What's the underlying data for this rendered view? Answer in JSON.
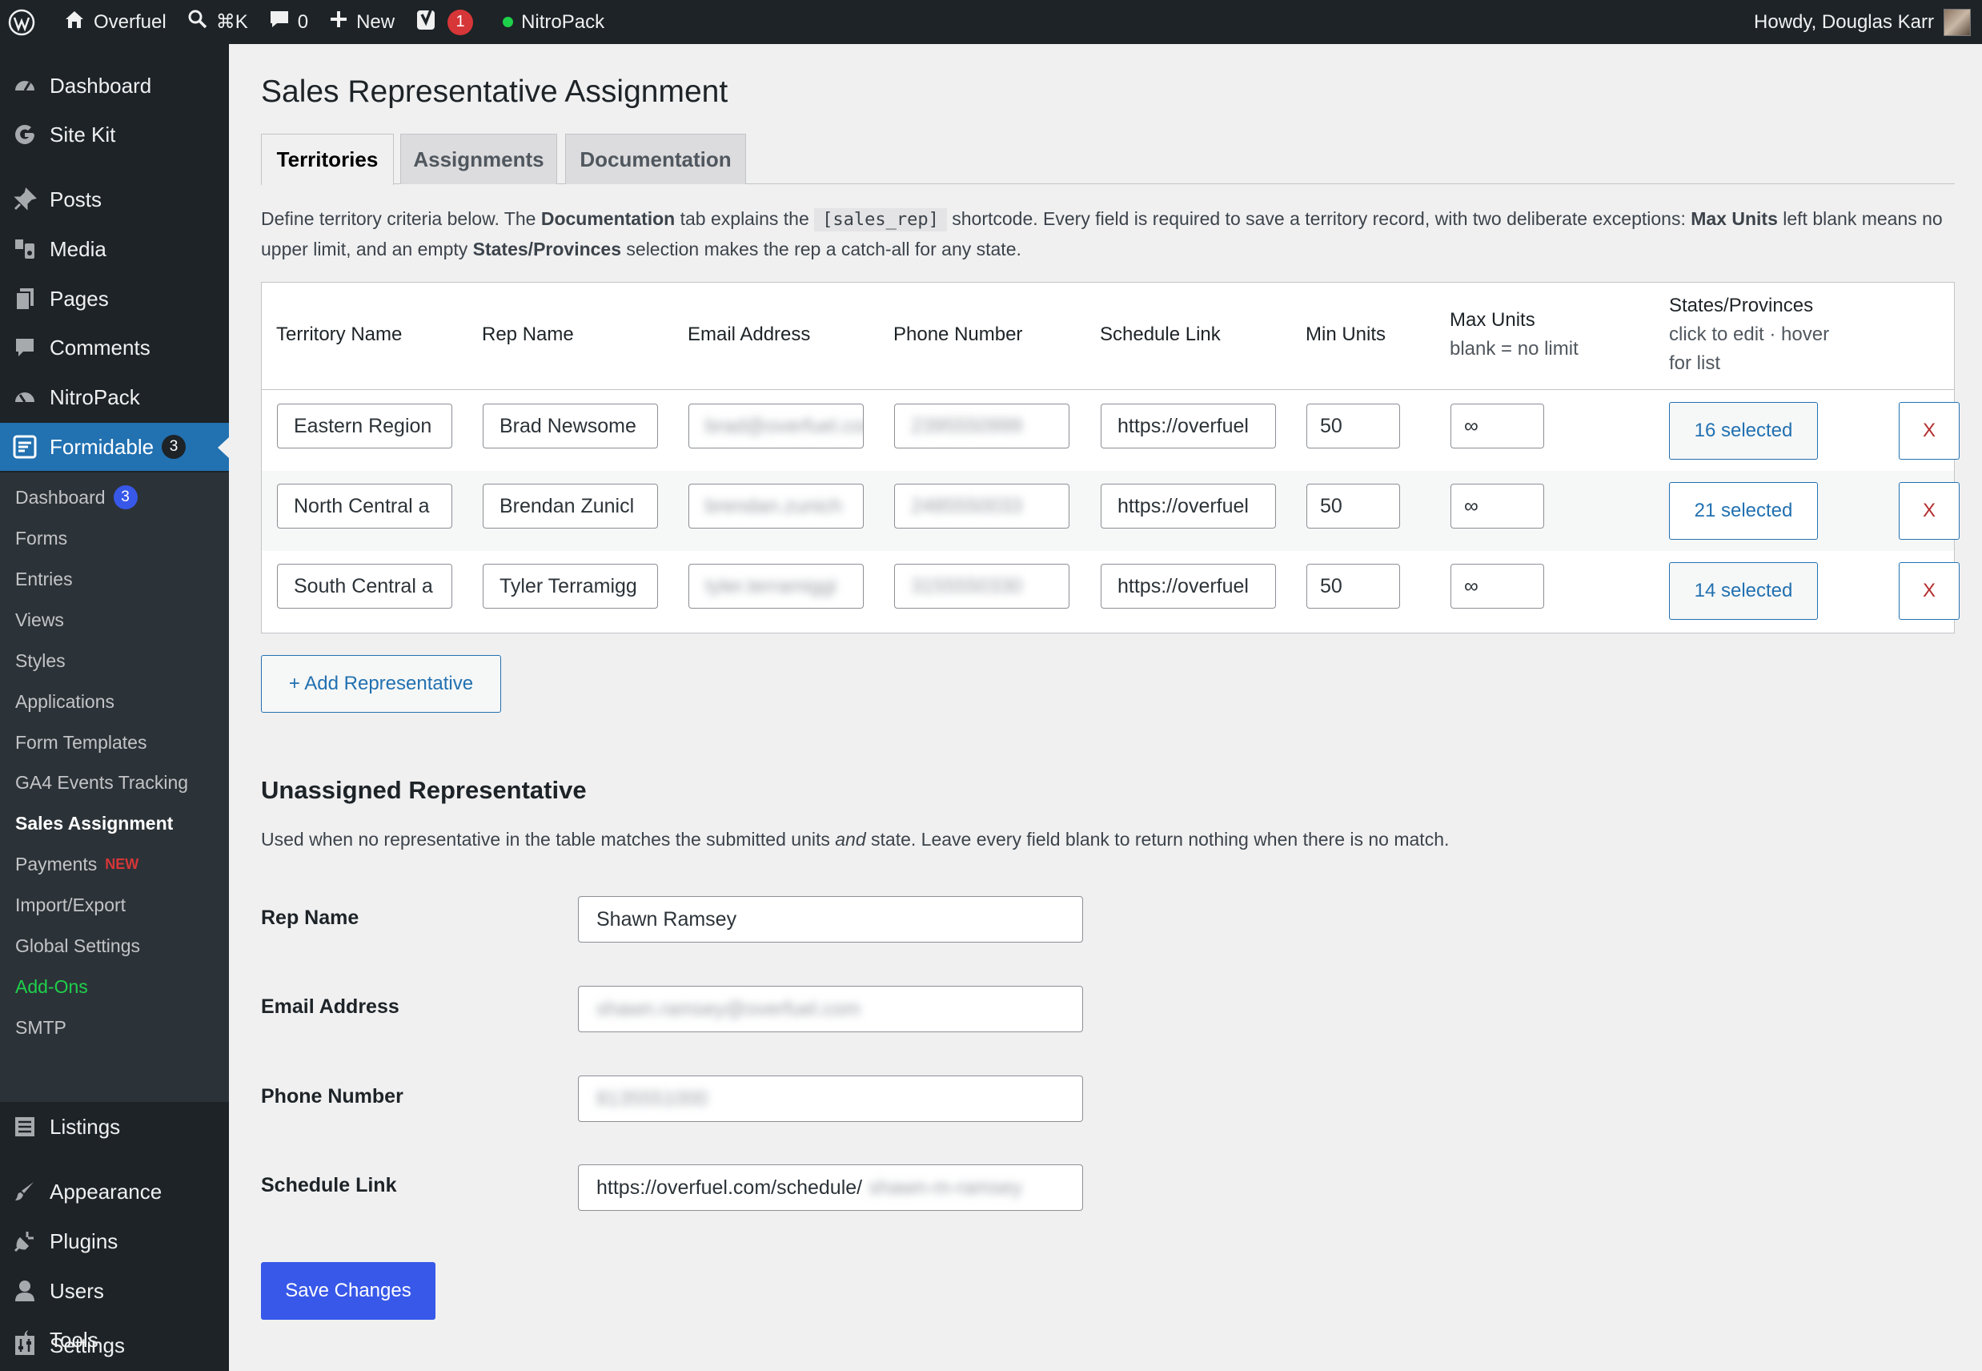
{
  "admin_bar": {
    "site_name": "Overfuel",
    "search_shortcut": "⌘K",
    "comments_count": "0",
    "new_label": "New",
    "yoast_count": "1",
    "nitropack_label": "NitroPack",
    "greeting": "Howdy, Douglas Karr"
  },
  "sidebar": {
    "top_items": [
      {
        "label": "Dashboard",
        "icon": "dashboard-icon"
      },
      {
        "label": "Site Kit",
        "icon": "google-icon"
      },
      {
        "label": "Posts",
        "icon": "pin-icon"
      },
      {
        "label": "Media",
        "icon": "media-icon"
      },
      {
        "label": "Pages",
        "icon": "pages-icon"
      },
      {
        "label": "Comments",
        "icon": "comment-icon"
      },
      {
        "label": "NitroPack",
        "icon": "gauge-icon"
      }
    ],
    "formidable": {
      "label": "Formidable",
      "count": "3"
    },
    "submenu": [
      {
        "label": "Dashboard",
        "badge": "3"
      },
      {
        "label": "Forms"
      },
      {
        "label": "Entries"
      },
      {
        "label": "Views"
      },
      {
        "label": "Styles"
      },
      {
        "label": "Applications"
      },
      {
        "label": "Form Templates"
      },
      {
        "label": "GA4 Events Tracking"
      },
      {
        "label": "Sales Assignment"
      },
      {
        "label": "Payments",
        "tag": "NEW"
      },
      {
        "label": "Import/Export"
      },
      {
        "label": "Global Settings"
      },
      {
        "label": "Add-Ons"
      },
      {
        "label": "SMTP"
      }
    ],
    "bottom_items": [
      {
        "label": "Listings",
        "icon": "list-icon"
      },
      {
        "label": "Appearance",
        "icon": "brush-icon"
      },
      {
        "label": "Plugins",
        "icon": "plug-icon"
      },
      {
        "label": "Users",
        "icon": "user-icon"
      },
      {
        "label": "Tools",
        "icon": "wrench-icon"
      },
      {
        "label": "Settings",
        "icon": "sliders-icon"
      }
    ]
  },
  "page": {
    "title": "Sales Representative Assignment",
    "tabs": [
      "Territories",
      "Assignments",
      "Documentation"
    ],
    "intro": {
      "p1": "Define territory criteria below. The ",
      "b1": "Documentation",
      "p2": " tab explains the ",
      "code": "[sales_rep]",
      "p3": " shortcode. Every field is required to save a territory record, with two deliberate exceptions: ",
      "b2": "Max Units",
      "p4": " left blank means no upper limit, and an empty ",
      "b3": "States/Provinces",
      "p5": " selection makes the rep a catch-all for any state."
    }
  },
  "table": {
    "headers": {
      "territory": "Territory Name",
      "rep": "Rep Name",
      "email": "Email Address",
      "phone": "Phone Number",
      "schedule": "Schedule Link",
      "min": "Min Units",
      "max": "Max Units",
      "max_sub": "blank = no limit",
      "states": "States/Provinces",
      "states_sub1": "click to edit · hover",
      "states_sub2": "for list"
    },
    "rows": [
      {
        "territory": "Eastern Region",
        "rep": "Brad Newsome",
        "email": "brad@overfuel.com",
        "phone": "2395550999",
        "schedule": "https://overfuel",
        "min": "50",
        "max": "∞",
        "states": "16 selected",
        "delete": "X"
      },
      {
        "territory": "North Central a",
        "rep": "Brendan Zunicl",
        "email": "brendan.zunich",
        "phone": "2485550033",
        "schedule": "https://overfuel",
        "min": "50",
        "max": "∞",
        "states": "21 selected",
        "delete": "X"
      },
      {
        "territory": "South Central a",
        "rep": "Tyler Terramigg",
        "email": "tyler.terramiggi",
        "phone": "3155550330",
        "schedule": "https://overfuel",
        "min": "50",
        "max": "∞",
        "states": "14 selected",
        "delete": "X"
      }
    ]
  },
  "add_button": "+ Add Representative",
  "unassigned": {
    "title": "Unassigned Representative",
    "desc_pre": "Used when no representative in the table matches the submitted units ",
    "desc_em": "and",
    "desc_post": " state. Leave every field blank to return nothing when there is no match.",
    "fields": {
      "rep_label": "Rep Name",
      "rep_value": "Shawn Ramsey",
      "email_label": "Email Address",
      "email_value": "shawn.ramsey@overfuel.com",
      "phone_label": "Phone Number",
      "phone_value": "8135551000",
      "schedule_label": "Schedule Link",
      "schedule_value": "https://overfuel.com/schedule/",
      "schedule_blur": "shawn-m-ramsey"
    }
  },
  "save_button": "Save Changes",
  "colors": {
    "admin_bg": "#1d2327",
    "accent": "#2271b1",
    "primary_button": "#3858e9",
    "danger": "#b32d2e"
  }
}
